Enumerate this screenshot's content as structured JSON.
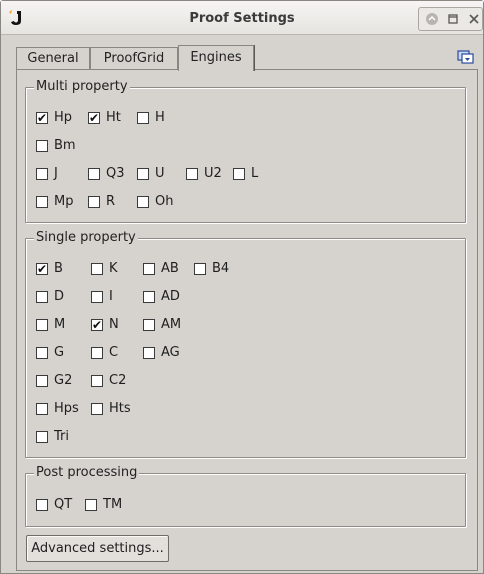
{
  "window": {
    "title": "Proof Settings"
  },
  "tabs": [
    {
      "label": "General",
      "active": false
    },
    {
      "label": "ProofGrid",
      "active": false
    },
    {
      "label": "Engines",
      "active": true
    }
  ],
  "groups": {
    "multi": {
      "title": "Multi property",
      "items": [
        {
          "label": "Hp",
          "checked": true
        },
        {
          "label": "Ht",
          "checked": true
        },
        {
          "label": "H",
          "checked": false
        },
        {
          "label": "Bm",
          "checked": false
        },
        {
          "label": "J",
          "checked": false
        },
        {
          "label": "Q3",
          "checked": false
        },
        {
          "label": "U",
          "checked": false
        },
        {
          "label": "U2",
          "checked": false
        },
        {
          "label": "L",
          "checked": false
        },
        {
          "label": "Mp",
          "checked": false
        },
        {
          "label": "R",
          "checked": false
        },
        {
          "label": "Oh",
          "checked": false
        }
      ]
    },
    "single": {
      "title": "Single property",
      "items": [
        {
          "label": "B",
          "checked": true
        },
        {
          "label": "K",
          "checked": false
        },
        {
          "label": "AB",
          "checked": false
        },
        {
          "label": "B4",
          "checked": false
        },
        {
          "label": "D",
          "checked": false
        },
        {
          "label": "I",
          "checked": false
        },
        {
          "label": "AD",
          "checked": false
        },
        {
          "label": "M",
          "checked": false
        },
        {
          "label": "N",
          "checked": true
        },
        {
          "label": "AM",
          "checked": false
        },
        {
          "label": "G",
          "checked": false
        },
        {
          "label": "C",
          "checked": false
        },
        {
          "label": "AG",
          "checked": false
        },
        {
          "label": "G2",
          "checked": false
        },
        {
          "label": "C2",
          "checked": false
        },
        {
          "label": "Hps",
          "checked": false
        },
        {
          "label": "Hts",
          "checked": false
        },
        {
          "label": "Tri",
          "checked": false
        }
      ]
    },
    "post": {
      "title": "Post processing",
      "items": [
        {
          "label": "QT",
          "checked": false
        },
        {
          "label": "TM",
          "checked": false
        }
      ]
    }
  },
  "advanced_button": "Advanced settings...",
  "icons": {
    "app": "java-app-icon",
    "minimize": "minimize-icon",
    "maximize": "maximize-icon",
    "close": "close-icon",
    "tabs_menu": "tab-list-icon"
  },
  "colors": {
    "background": "#d6d3ce",
    "border": "#8a8782",
    "titlebar": "#eeece9",
    "app_icon_accent": "#f0a020"
  }
}
